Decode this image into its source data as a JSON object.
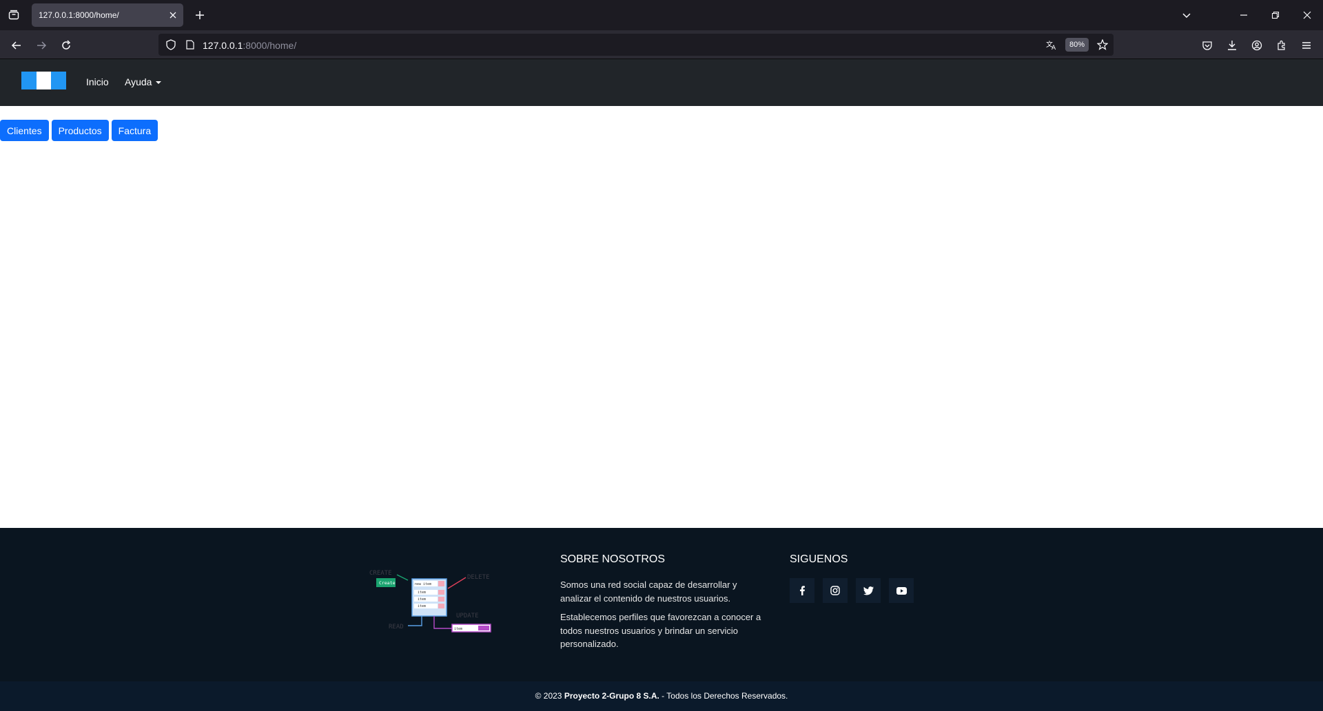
{
  "browser": {
    "tab_title": "127.0.0.1:8000/home/",
    "url_host": "127.0.0.1",
    "url_path": ":8000/home/",
    "zoom": "80%"
  },
  "site": {
    "nav": {
      "brand_colors": [
        "#2196f3",
        "#ffffff",
        "#2196f3"
      ],
      "links": [
        "Inicio",
        "Ayuda"
      ]
    },
    "buttons": [
      "Clientes",
      "Productos",
      "Factura"
    ],
    "accent": "#0d6efd"
  },
  "footer": {
    "diagram_labels": {
      "create": "CREATE",
      "create_btn": "Create",
      "delete": "DELETE",
      "update": "UPDATE",
      "read": "READ",
      "new_item": "new item",
      "item": "item"
    },
    "about_title": "SOBRE NOSOTROS",
    "about_p1": "Somos una red social capaz de desarrollar y analizar el contenido de nuestros usuarios.",
    "about_p2": "Establecemos perfiles que favorezcan a conocer a todos nuestros usuarios y brindar un servicio personalizado.",
    "follow_title": "SIGUENOS",
    "social_icons": [
      "facebook-icon",
      "instagram-icon",
      "twitter-icon",
      "youtube-icon"
    ],
    "copyright_prefix": "© 2023 ",
    "copyright_bold": "Proyecto 2-Grupo 8 S.A.",
    "copyright_suffix": " - Todos los Derechos Reservados."
  }
}
